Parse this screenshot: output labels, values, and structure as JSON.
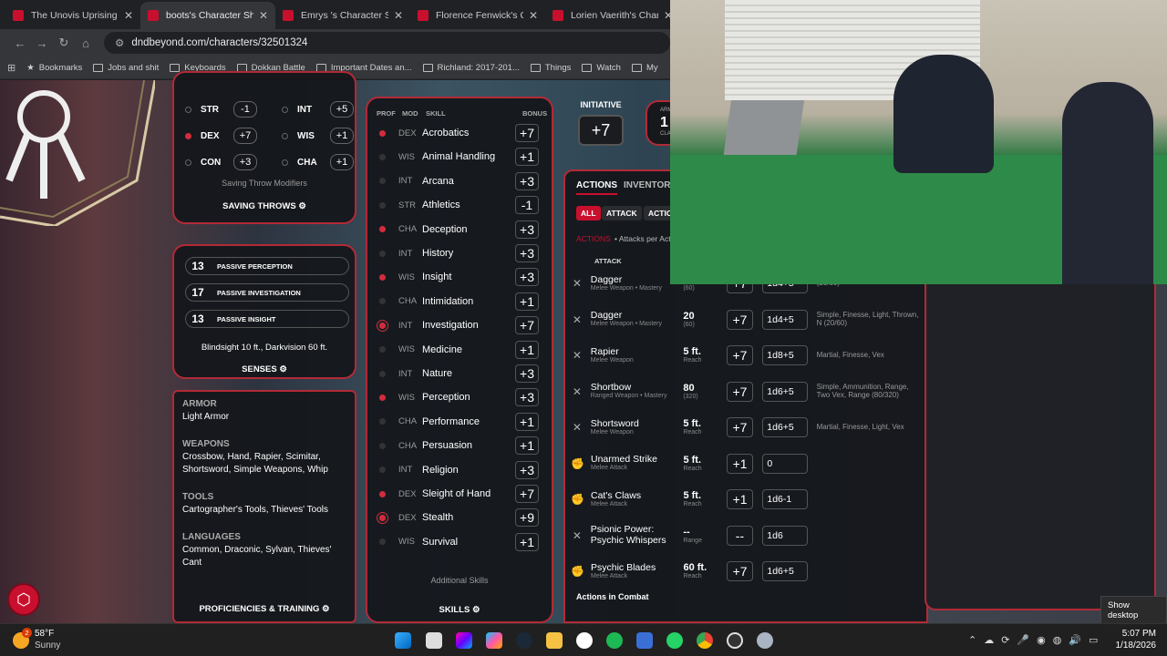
{
  "browser": {
    "tabs": [
      {
        "title": "The Unovis Uprising - C",
        "active": false
      },
      {
        "title": "boots's Character Sheet",
        "active": true
      },
      {
        "title": "Emrys 's Character Shee",
        "active": false
      },
      {
        "title": "Florence Fenwick's Char",
        "active": false
      },
      {
        "title": "Lorien Vaerith's Charact",
        "active": false
      }
    ],
    "url": "dndbeyond.com/characters/32501324",
    "bookmarks": [
      "Bookmarks",
      "Jobs and shit",
      "Keyboards",
      "Dokkan Battle",
      "Important Dates an...",
      "Richland: 2017-201...",
      "Things",
      "Watch",
      "My"
    ]
  },
  "saving_throws": {
    "items": [
      {
        "ability": "STR",
        "value": "-1",
        "proficient": false
      },
      {
        "ability": "INT",
        "value": "+5",
        "proficient": false
      },
      {
        "ability": "DEX",
        "value": "+7",
        "proficient": true
      },
      {
        "ability": "WIS",
        "value": "+1",
        "proficient": false
      },
      {
        "ability": "CON",
        "value": "+3",
        "proficient": false
      },
      {
        "ability": "CHA",
        "value": "+1",
        "proficient": false
      }
    ],
    "modifiers_label": "Saving Throw Modifiers",
    "title": "SAVING THROWS"
  },
  "senses": {
    "passives": [
      {
        "value": "13",
        "label": "PASSIVE PERCEPTION"
      },
      {
        "value": "17",
        "label": "PASSIVE INVESTIGATION"
      },
      {
        "value": "13",
        "label": "PASSIVE INSIGHT"
      }
    ],
    "text": "Blindsight 10 ft., Darkvision 60 ft.",
    "title": "SENSES"
  },
  "proficiencies": {
    "armor_label": "ARMOR",
    "armor": "Light Armor",
    "weapons_label": "WEAPONS",
    "weapons": "Crossbow, Hand, Rapier, Scimitar, Shortsword, Simple Weapons, Whip",
    "tools_label": "TOOLS",
    "tools": "Cartographer's Tools, Thieves' Tools",
    "languages_label": "LANGUAGES",
    "languages": "Common, Draconic, Sylvan, Thieves' Cant",
    "title": "PROFICIENCIES & TRAINING"
  },
  "skills": {
    "headers": {
      "prof": "PROF",
      "mod": "MOD",
      "skill": "SKILL",
      "bonus": "BONUS"
    },
    "items": [
      {
        "prof": "on",
        "mod": "DEX",
        "name": "Acrobatics",
        "bonus": "+7"
      },
      {
        "prof": "off",
        "mod": "WIS",
        "name": "Animal Handling",
        "bonus": "+1"
      },
      {
        "prof": "off",
        "mod": "INT",
        "name": "Arcana",
        "bonus": "+3"
      },
      {
        "prof": "off",
        "mod": "STR",
        "name": "Athletics",
        "bonus": "-1"
      },
      {
        "prof": "on",
        "mod": "CHA",
        "name": "Deception",
        "bonus": "+3"
      },
      {
        "prof": "off",
        "mod": "INT",
        "name": "History",
        "bonus": "+3"
      },
      {
        "prof": "on",
        "mod": "WIS",
        "name": "Insight",
        "bonus": "+3"
      },
      {
        "prof": "off",
        "mod": "CHA",
        "name": "Intimidation",
        "bonus": "+1"
      },
      {
        "prof": "exp",
        "mod": "INT",
        "name": "Investigation",
        "bonus": "+7"
      },
      {
        "prof": "off",
        "mod": "WIS",
        "name": "Medicine",
        "bonus": "+1"
      },
      {
        "prof": "off",
        "mod": "INT",
        "name": "Nature",
        "bonus": "+3"
      },
      {
        "prof": "on",
        "mod": "WIS",
        "name": "Perception",
        "bonus": "+3"
      },
      {
        "prof": "off",
        "mod": "CHA",
        "name": "Performance",
        "bonus": "+1"
      },
      {
        "prof": "off",
        "mod": "CHA",
        "name": "Persuasion",
        "bonus": "+1"
      },
      {
        "prof": "off",
        "mod": "INT",
        "name": "Religion",
        "bonus": "+3"
      },
      {
        "prof": "on",
        "mod": "DEX",
        "name": "Sleight of Hand",
        "bonus": "+7"
      },
      {
        "prof": "exp",
        "mod": "DEX",
        "name": "Stealth",
        "bonus": "+9"
      },
      {
        "prof": "off",
        "mod": "WIS",
        "name": "Survival",
        "bonus": "+1"
      }
    ],
    "additional": "Additional Skills",
    "title": "SKILLS"
  },
  "initiative": {
    "label": "INITIATIVE",
    "value": "+7"
  },
  "armor_class": {
    "label_top": "ARM",
    "value": "1",
    "label_bottom": "CLA"
  },
  "actions": {
    "tabs": [
      "ACTIONS",
      "INVENTORY"
    ],
    "filters": [
      "ALL",
      "ATTACK",
      "ACTION"
    ],
    "subheader_red": "ACTIONS",
    "subheader_rest": "• Attacks per Act",
    "col_attack": "ATTACK",
    "rows": [
      {
        "icon": "✕",
        "name": "Dagger",
        "sub": "Melee Weapon • Mastery",
        "range": "20",
        "range_sub": "(60)",
        "hit": "+7",
        "damage": "1d4+5",
        "notes": "(20/60)"
      },
      {
        "icon": "✕",
        "name": "Dagger",
        "sub": "Melee Weapon • Mastery",
        "range": "20",
        "range_sub": "(60)",
        "hit": "+7",
        "damage": "1d4+5",
        "notes": "Simple, Finesse, Light, Thrown, N (20/60)"
      },
      {
        "icon": "✕",
        "name": "Rapier",
        "sub": "Melee Weapon",
        "range": "5 ft.",
        "range_sub": "Reach",
        "hit": "+7",
        "damage": "1d8+5",
        "notes": "Martial, Finesse, Vex"
      },
      {
        "icon": "✕",
        "name": "Shortbow",
        "sub": "Ranged Weapon • Mastery",
        "range": "80",
        "range_sub": "(320)",
        "hit": "+7",
        "damage": "1d6+5",
        "notes": "Simple, Ammunition, Range, Two Vex, Range (80/320)"
      },
      {
        "icon": "✕",
        "name": "Shortsword",
        "sub": "Melee Weapon",
        "range": "5 ft.",
        "range_sub": "Reach",
        "hit": "+7",
        "damage": "1d6+5",
        "notes": "Martial, Finesse, Light, Vex"
      },
      {
        "icon": "✊",
        "name": "Unarmed Strike",
        "sub": "Melee Attack",
        "range": "5 ft.",
        "range_sub": "Reach",
        "hit": "+1",
        "damage": "0",
        "notes": ""
      },
      {
        "icon": "✊",
        "name": "Cat's Claws",
        "sub": "Melee Attack",
        "range": "5 ft.",
        "range_sub": "Reach",
        "hit": "+1",
        "damage": "1d6-1",
        "notes": ""
      },
      {
        "icon": "✕",
        "name": "Psionic Power: Psychic Whispers",
        "sub": "",
        "range": "--",
        "range_sub": "Range",
        "hit": "--",
        "damage": "1d6",
        "notes": ""
      },
      {
        "icon": "✊",
        "name": "Psychic Blades",
        "sub": "Melee Attack",
        "range": "60 ft.",
        "range_sub": "Reach",
        "hit": "+7",
        "damage": "1d6+5",
        "notes": ""
      }
    ],
    "footer": "Actions in Combat"
  },
  "show_desktop": "Show desktop",
  "taskbar": {
    "temp": "58°F",
    "weather": "Sunny",
    "weather_badge": "2",
    "time": "5:07 PM",
    "date": "1/18/2026"
  },
  "colors": {
    "accent": "#c8102e",
    "panel_border": "#b22a37",
    "proficient_dot": "#d22c3c"
  }
}
